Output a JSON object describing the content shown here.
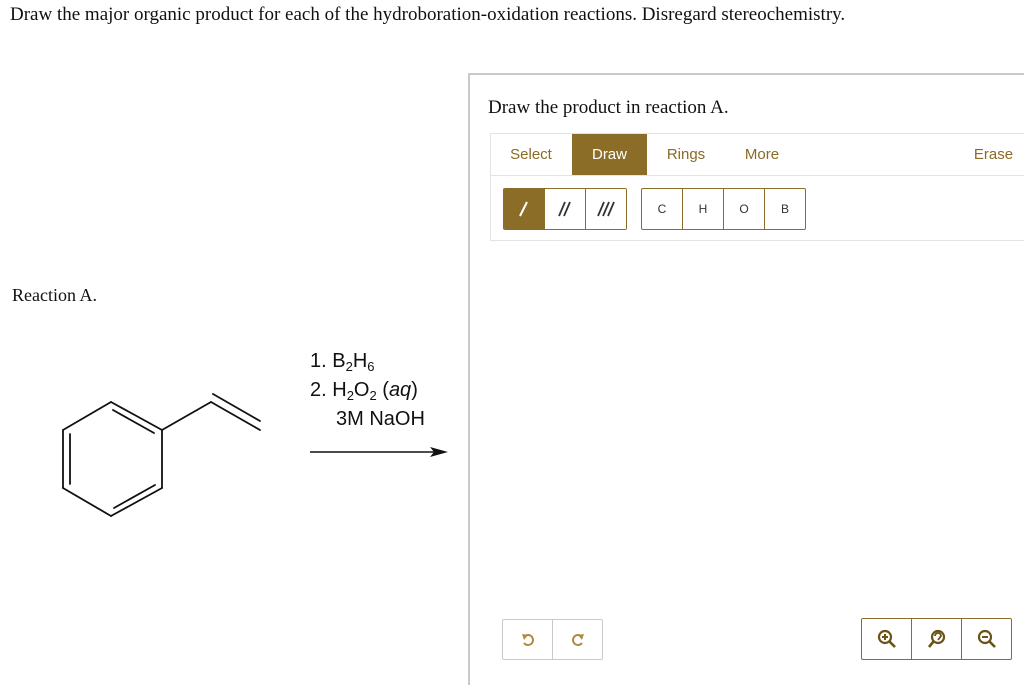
{
  "question": {
    "title": "Draw the major organic product for each of the hydroboration-oxidation reactions. Disregard stereochemistry."
  },
  "reaction": {
    "label": "Reaction A.",
    "conditions": {
      "step1_prefix": "1. B",
      "step1_sub1": "2",
      "step1_mid": "H",
      "step1_sub2": "6",
      "step2_prefix": "2. H",
      "step2_sub1": "2",
      "step2_mid": "O",
      "step2_sub2": "2",
      "step2_suffix": " (aq)",
      "step3": "3M NaOH"
    }
  },
  "editor": {
    "prompt": "Draw the product in reaction A.",
    "tabs": {
      "select": "Select",
      "draw": "Draw",
      "rings": "Rings",
      "more": "More",
      "erase": "Erase"
    },
    "active_tab": "Draw",
    "bonds": [
      "single-bond-icon",
      "double-bond-icon",
      "triple-bond-icon"
    ],
    "atoms": {
      "c": "C",
      "h": "H",
      "o": "O",
      "b": "B"
    },
    "history": [
      "undo-icon",
      "redo-icon"
    ],
    "zoom": [
      "zoom-in-icon",
      "zoom-reset-icon",
      "zoom-out-icon"
    ]
  },
  "colors": {
    "accent": "#8c6d28",
    "accent_text": "#8a6a24",
    "border": "#c9c9c9"
  }
}
